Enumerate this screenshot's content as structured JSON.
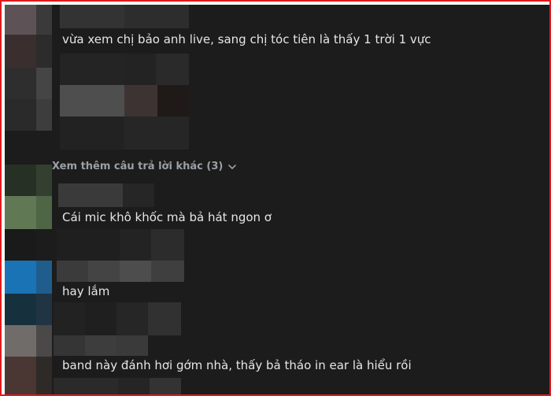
{
  "comments": [
    {
      "text": "vừa xem chị bảo anh live, sang chị tóc tiên là thấy 1 trời 1 vực"
    },
    {
      "text": "Cái mic khô khốc mà bả hát ngon ơ"
    },
    {
      "text": "hay lắm"
    },
    {
      "text": "band này đánh hơi gớm nhà, thấy bả tháo in ear là hiểu rồi"
    }
  ],
  "more_replies": {
    "label": "Xem thêm câu trả lời khác (3)",
    "icon": "chevron-down-icon"
  },
  "colors": {
    "background": "#1c1c1c",
    "text": "#e6e6e6",
    "muted": "#9aa0a6",
    "frame": "#e0191c"
  }
}
